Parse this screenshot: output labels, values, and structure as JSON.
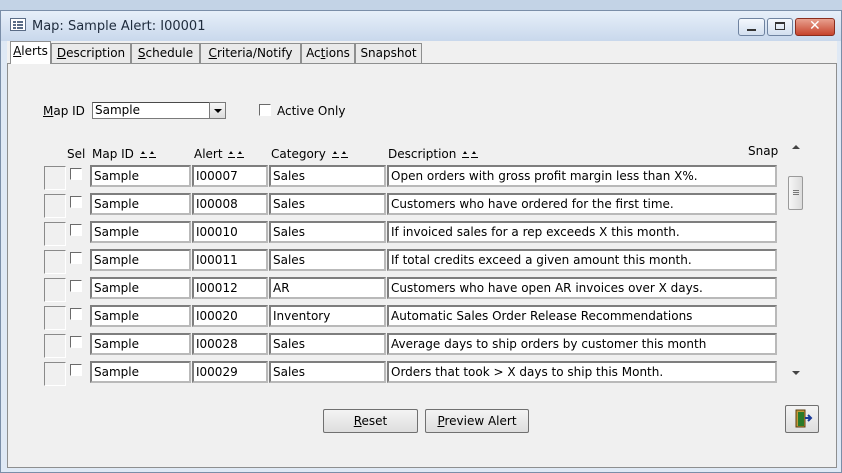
{
  "window": {
    "title": "Map: Sample  Alert: I00001"
  },
  "tabs": [
    {
      "label": "Alerts",
      "mnemonic": "A",
      "rest": "lerts"
    },
    {
      "label": "Description",
      "mnemonic": "D",
      "rest": "escription"
    },
    {
      "label": "Schedule",
      "mnemonic": "S",
      "rest": "chedule"
    },
    {
      "label": "Criteria/Notify",
      "mnemonic": "C",
      "rest": "riteria/Notify"
    },
    {
      "label": "Actions",
      "pre": "Ac",
      "mnemonic": "t",
      "rest": "ions"
    },
    {
      "label": "Snapshot",
      "pre": "",
      "mnemonic": "",
      "rest": "Snapshot"
    }
  ],
  "filter": {
    "map_id_label_mn": "M",
    "map_id_label_rest": "ap ID",
    "map_id_value": "Sample",
    "active_only_label": "Active Only",
    "active_only_checked": false
  },
  "columns": {
    "sel": "Sel",
    "map_id": "Map ID",
    "alert": "Alert",
    "category": "Category",
    "description": "Description",
    "snap": "Snap"
  },
  "rows": [
    {
      "map_id": "Sample",
      "alert": "I00007",
      "category": "Sales",
      "description": "Open orders with gross profit margin less than X%."
    },
    {
      "map_id": "Sample",
      "alert": "I00008",
      "category": "Sales",
      "description": "Customers who have ordered for the first time."
    },
    {
      "map_id": "Sample",
      "alert": "I00010",
      "category": "Sales",
      "description": "If invoiced sales for a rep exceeds X this month."
    },
    {
      "map_id": "Sample",
      "alert": "I00011",
      "category": "Sales",
      "description": "If total credits exceed a given amount this month."
    },
    {
      "map_id": "Sample",
      "alert": "I00012",
      "category": "AR",
      "description": "Customers who have open AR invoices over X days."
    },
    {
      "map_id": "Sample",
      "alert": "I00020",
      "category": "Inventory",
      "description": "Automatic Sales Order Release Recommendations"
    },
    {
      "map_id": "Sample",
      "alert": "I00028",
      "category": "Sales",
      "description": "Average days to ship orders by customer this month"
    },
    {
      "map_id": "Sample",
      "alert": "I00029",
      "category": "Sales",
      "description": "Orders that took > X days to ship this Month."
    }
  ],
  "buttons": {
    "reset_mn": "R",
    "reset_rest": "eset",
    "preview_mn": "P",
    "preview_rest": "review Alert"
  },
  "icons": {
    "window_icon": "form-icon",
    "exit": "exit-door-icon"
  },
  "colors": {
    "titlebar": "#c9d8ec",
    "close": "#c6432c"
  }
}
